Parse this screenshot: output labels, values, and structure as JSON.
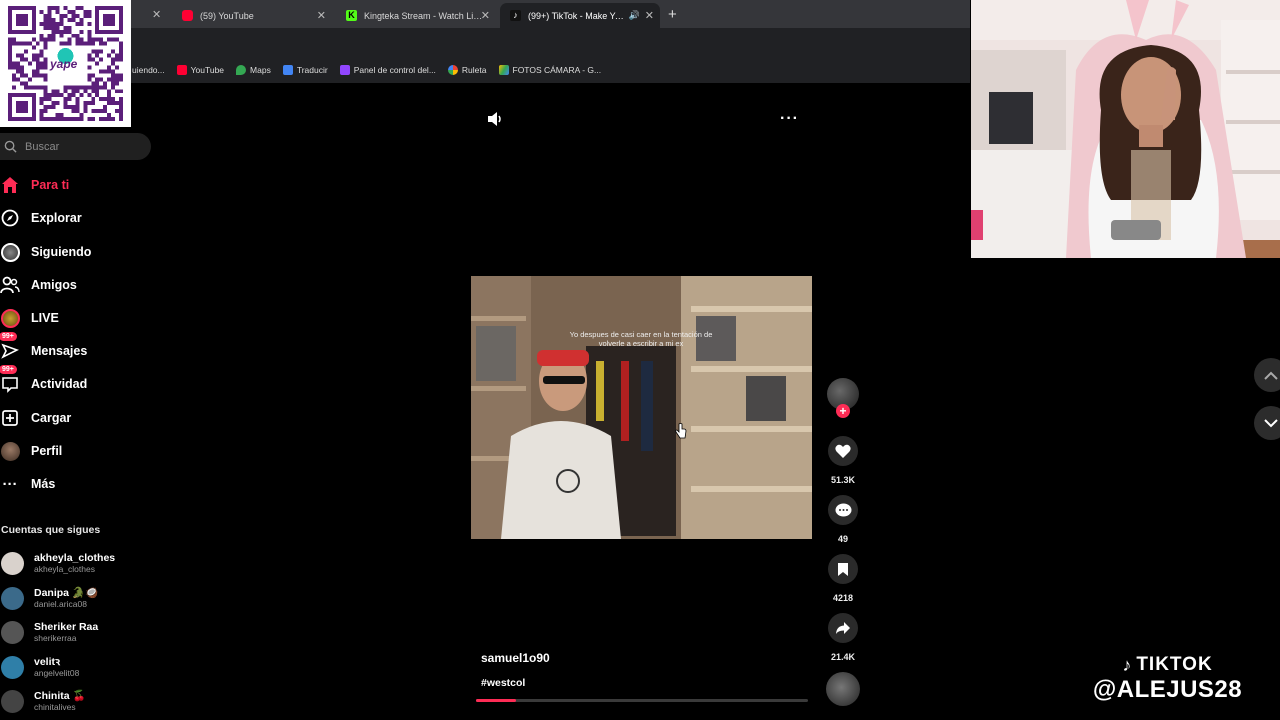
{
  "browser": {
    "tabs": [
      {
        "label": "(59) YouTube",
        "favicon": "youtube-icon"
      },
      {
        "label": "Kingteka Stream - Watch Live o",
        "favicon": "kick-icon"
      },
      {
        "label": "(99+) TikTok - Make Your Da",
        "favicon": "tiktok-icon",
        "active": true
      }
    ],
    "bookmarks": [
      {
        "label": "uiendo...",
        "icon": "bookmark-icon"
      },
      {
        "label": "YouTube",
        "icon": "youtube-icon",
        "color": "#ff0033"
      },
      {
        "label": "Maps",
        "icon": "maps-icon",
        "color": "#34a853"
      },
      {
        "label": "Traducir",
        "icon": "translate-icon",
        "color": "#4285f4"
      },
      {
        "label": "Panel de control del...",
        "icon": "panel-icon",
        "color": "#9146ff"
      },
      {
        "label": "Ruleta",
        "icon": "wheel-icon",
        "color": "#ea4335"
      },
      {
        "label": "FOTOS CÁMARA - G...",
        "icon": "drive-icon",
        "color": "#fbbc04"
      }
    ]
  },
  "qr": {
    "brand": "yape"
  },
  "sidebar": {
    "search_placeholder": "Buscar",
    "nav": [
      {
        "label": "Para ti",
        "icon": "home-icon",
        "selected": true
      },
      {
        "label": "Explorar",
        "icon": "compass-icon"
      },
      {
        "label": "Siguiendo",
        "icon": "following-avatar-icon"
      },
      {
        "label": "Amigos",
        "icon": "friends-icon"
      },
      {
        "label": "LIVE",
        "icon": "live-icon"
      },
      {
        "label": "Mensajes",
        "icon": "messages-icon",
        "badge": "99+"
      },
      {
        "label": "Actividad",
        "icon": "activity-icon",
        "badge": "99+"
      },
      {
        "label": "Cargar",
        "icon": "upload-icon"
      },
      {
        "label": "Perfil",
        "icon": "profile-avatar-icon"
      },
      {
        "label": "Más",
        "icon": "more-icon"
      }
    ],
    "following_header": "Cuentas que sigues",
    "following": [
      {
        "name": "akheyla_clothes",
        "handle": "akheyla_clothes",
        "color": "#d9d2cc"
      },
      {
        "name": "Danipa 🐊🥥",
        "handle": "daniel.arica08",
        "color": "#3b6a8a"
      },
      {
        "name": "Sheriker Raa",
        "handle": "sherikerraa",
        "color": "#555555"
      },
      {
        "name": "velitꝛ",
        "handle": "angelvelit08",
        "color": "#2f7fa8"
      },
      {
        "name": "Chinita 🍒",
        "handle": "chinitalives",
        "color": "#444444"
      }
    ]
  },
  "video": {
    "caption": "Yo despues de casi caer en la tentación de volverle a escribir a mi ex",
    "creator": "samuel1o90",
    "hashtag": "#westcol",
    "progress": 0.12,
    "stats": {
      "likes": "51.3K",
      "comments": "49",
      "saves": "4218",
      "shares": "21.4K"
    }
  },
  "overlay": {
    "brand": "TIKTOK",
    "handle": "@ALEJUS28"
  },
  "colors": {
    "accent": "#fe2c55",
    "chrome": "#202124",
    "tabbar": "#35363a"
  }
}
